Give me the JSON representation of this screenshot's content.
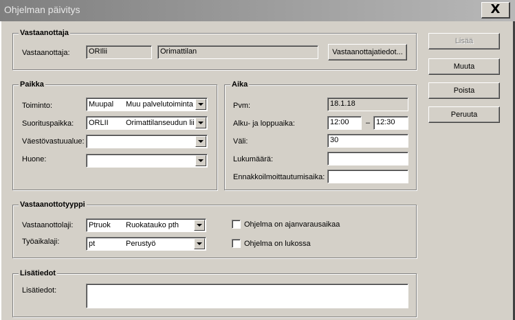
{
  "window": {
    "title": "Ohjelman päivitys",
    "close_label": "X"
  },
  "vastaanottaja": {
    "group_title": "Vastaanottaja",
    "label": "Vastaanottaja:",
    "code": "ORIlii",
    "name": "Orimattilan",
    "details_button": "Vastaanottajatiedot..."
  },
  "paikka": {
    "group_title": "Paikka",
    "toiminto": {
      "label": "Toiminto:",
      "code": "Muupal",
      "name": "Muu palvelutoiminta"
    },
    "suorituspaikka": {
      "label": "Suorituspaikka:",
      "code": "ORLII",
      "name": "Orimattilanseudun lii"
    },
    "vaestovastuualue": {
      "label": "Väestövastuualue:",
      "code": "",
      "name": ""
    },
    "huone": {
      "label": "Huone:",
      "code": "",
      "name": ""
    }
  },
  "aika": {
    "group_title": "Aika",
    "pvm": {
      "label": "Pvm:",
      "value": "18.1.18"
    },
    "alku_loppu": {
      "label": "Alku- ja loppuaika:",
      "start": "12:00",
      "separator": "–",
      "end": "12:30"
    },
    "vali": {
      "label": "Väli:",
      "value": "30"
    },
    "lukumaara": {
      "label": "Lukumäärä:",
      "value": ""
    },
    "ennakko": {
      "label": "Ennakkoilmoittautumisaika:",
      "value": ""
    }
  },
  "vastaanottotyyppi": {
    "group_title": "Vastaanottotyyppi",
    "laji": {
      "label": "Vastaanottolaji:",
      "code": "Ptruok",
      "name": "Ruokatauko pth"
    },
    "tyoaikalaji": {
      "label": "Työaikalaji:",
      "code": "pt",
      "name": "Perustyö"
    },
    "ajanvaraus": {
      "label": "Ohjelma on ajanvarausaikaa",
      "checked": false
    },
    "lukossa": {
      "label": "Ohjelma on lukossa",
      "checked": false
    }
  },
  "lisatiedot": {
    "group_title": "Lisätiedot",
    "label": "Lisätiedot:",
    "value": ""
  },
  "buttons": {
    "lisaa": "Lisää",
    "muuta": "Muuta",
    "poista": "Poista",
    "peruuta": "Peruuta"
  }
}
